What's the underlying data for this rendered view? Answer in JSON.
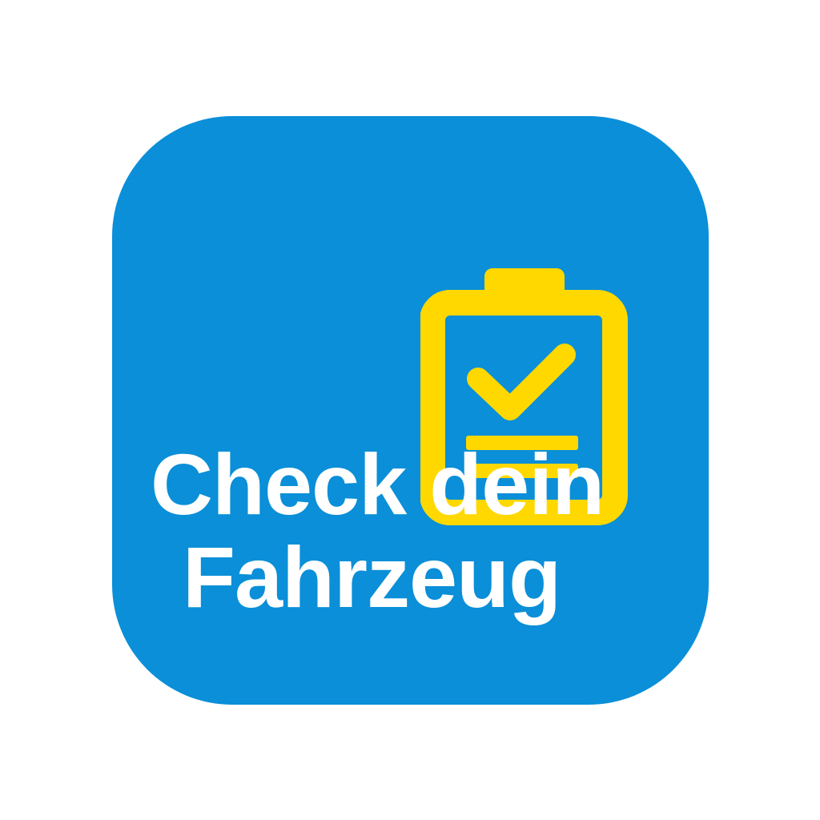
{
  "icon": {
    "name": "clipboard-check-icon",
    "background_color": "#0a8fd8",
    "accent_color": "#ffd800"
  },
  "title": {
    "line1": "Check dein",
    "line2": "Fahrzeug",
    "color": "#ffffff"
  }
}
